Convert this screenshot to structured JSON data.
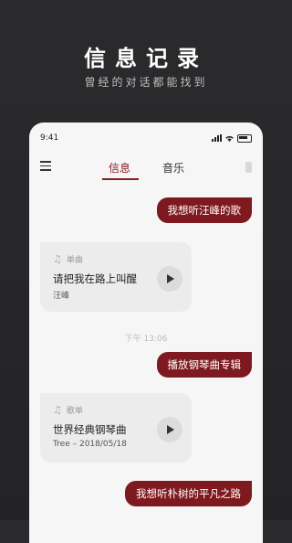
{
  "promo": {
    "title": "信息记录",
    "subtitle": "曾经的对话都能找到"
  },
  "status_bar": {
    "time": "9:41"
  },
  "tabs": [
    {
      "label": "信息",
      "active": true
    },
    {
      "label": "音乐",
      "active": false
    }
  ],
  "messages": {
    "user_1": "我想听汪峰的歌",
    "card_1": {
      "type": "单曲",
      "title": "请把我在路上叫醒",
      "meta": "汪峰"
    },
    "timestamp": "下午 13:06",
    "user_2": "播放钢琴曲专辑",
    "card_2": {
      "type": "歌单",
      "title": "世界经典钢琴曲",
      "meta": "Tree – 2018/05/18"
    },
    "user_3": "我想听朴树的平凡之路"
  },
  "colors": {
    "accent": "#7e1a1f",
    "background": "#262628",
    "card": "#ececec"
  },
  "icons": [
    "menu-icon",
    "music-note-icon",
    "play-icon",
    "signal-icon",
    "wifi-icon",
    "battery-icon"
  ]
}
